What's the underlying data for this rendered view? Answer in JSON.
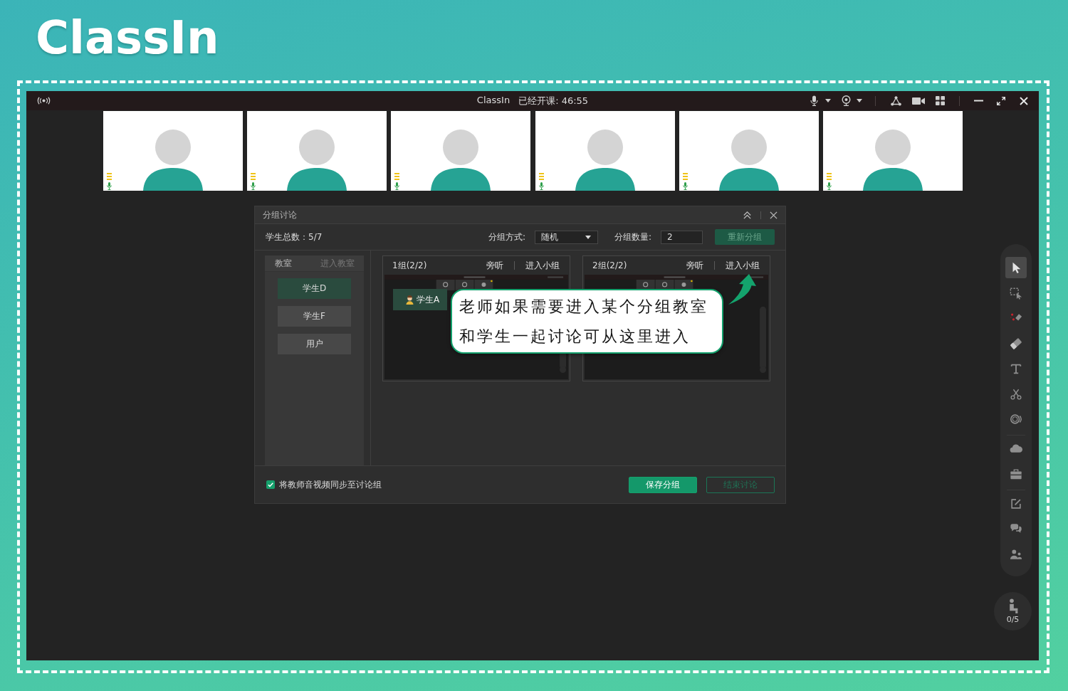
{
  "brand": {
    "logo": "ClassIn"
  },
  "window": {
    "app_name": "ClassIn",
    "class_timer": "已经开课: 46:55"
  },
  "video_tiles": [
    {
      "mic_on": true
    },
    {
      "mic_on": true
    },
    {
      "mic_on": true
    },
    {
      "mic_on": true
    },
    {
      "mic_on": true
    },
    {
      "mic_on": true
    }
  ],
  "dialog": {
    "title": "分组讨论",
    "student_total": "学生总数：5/7",
    "method_label": "分组方式:",
    "method_value": "随机",
    "count_label": "分组数量:",
    "count_value": "2",
    "regroup_button": {
      "label": "重新分组",
      "disabled": true
    },
    "classroom": {
      "title": "教室",
      "enter_link": {
        "label": "进入教室",
        "disabled": true
      },
      "students": [
        {
          "name": "学生D",
          "selected": true
        },
        {
          "name": "学生F",
          "selected": false
        },
        {
          "name": "用户",
          "selected": false
        }
      ]
    },
    "groups": [
      {
        "title": "1组(2/2)",
        "audit_link": "旁听",
        "enter_link": "进入小组",
        "members": [
          {
            "name": "学生A"
          }
        ]
      },
      {
        "title": "2组(2/2)",
        "audit_link": "旁听",
        "enter_link": "进入小组"
      }
    ],
    "sync_option": {
      "label": "将教师音视频同步至讨论组",
      "checked": true
    },
    "buttons": [
      {
        "label": "保存分组",
        "disabled": false
      },
      {
        "label": "结束讨论",
        "disabled": true
      }
    ]
  },
  "callout": {
    "lines": [
      "老师如果需要进入某个分组教室",
      "和学生一起讨论可从这里进入"
    ]
  },
  "tools": [
    {
      "selected": true
    },
    {
      "selected": false
    },
    {
      "selected": false
    },
    {
      "selected": false
    },
    {
      "selected": false
    },
    {
      "selected": false
    },
    {
      "selected": false
    },
    {
      "selected": false
    },
    {
      "selected": false
    },
    {
      "selected": false
    },
    {
      "selected": false
    },
    {
      "selected": false
    }
  ],
  "seat_counter": "0/5"
}
